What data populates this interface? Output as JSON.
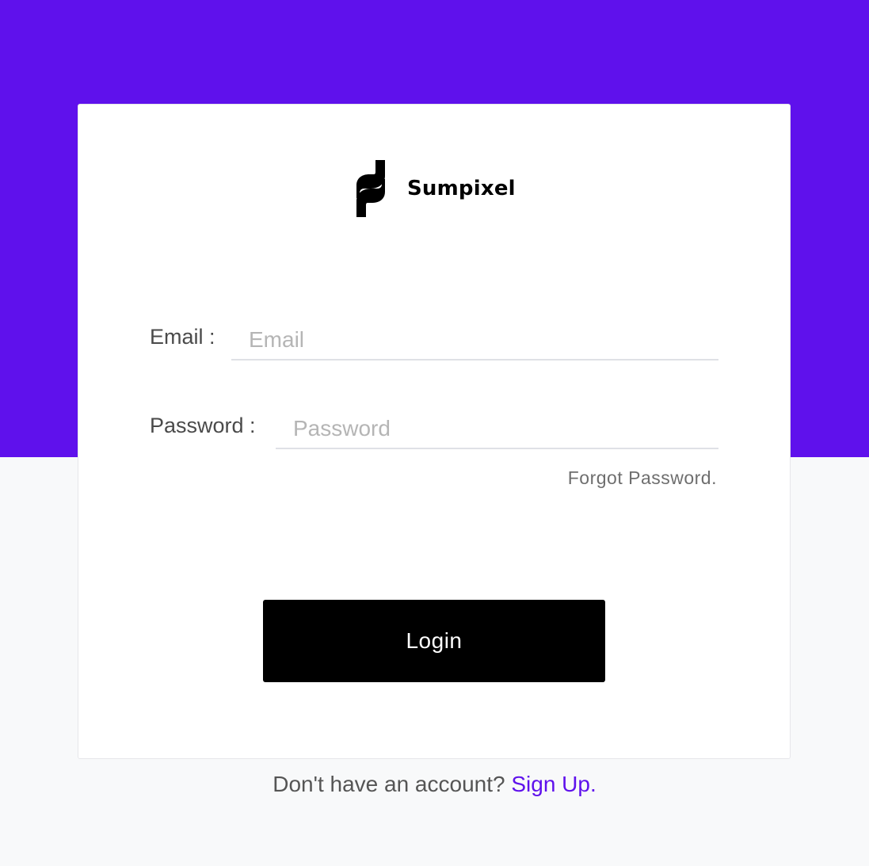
{
  "brand": {
    "name": "Sumpixel",
    "logo_icon": "sumpixel-s-logo-icon"
  },
  "colors": {
    "accent": "#5f11ec",
    "page_background": "#f8f9fa",
    "button": "#000000"
  },
  "form": {
    "email": {
      "label": "Email :",
      "placeholder": "Email",
      "value": ""
    },
    "password": {
      "label": "Password :",
      "placeholder": "Password",
      "value": ""
    },
    "forgot_password_label": "Forgot Password.",
    "login_label": "Login"
  },
  "footer": {
    "prompt": "Don't have an account?",
    "signup_label": "Sign Up."
  }
}
